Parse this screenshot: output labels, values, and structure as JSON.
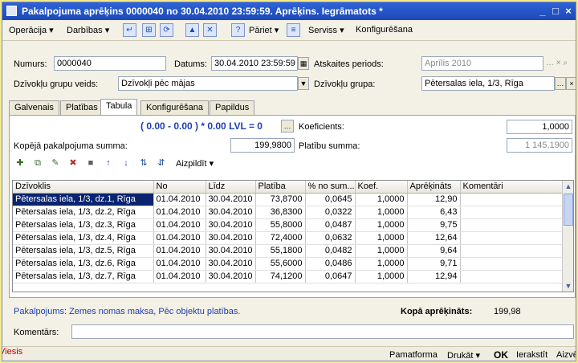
{
  "window": {
    "title": "Pakalpojuma aprēķins 0000040 no 30.04.2010 23:59:59. Aprēķins. Iegrāmatots *",
    "minimize": "_",
    "maximize": "□",
    "close": "×"
  },
  "menu": {
    "operacija": "Operācija ▾",
    "darbibas": "Darbības ▾",
    "pariet": "Pāriet ▾",
    "serviss": "Serviss ▾",
    "konfiguresana": "Konfigurēšana",
    "help": "?"
  },
  "header": {
    "numurs_label": "Numurs:",
    "numurs_value": "0000040",
    "datums_label": "Datums:",
    "datums_value": "30.04.2010 23:59:59",
    "atskaites_label": "Atskaites periods:",
    "atskaites_value": "Aprīlis 2010",
    "grupu_veids_label": "Dzīvokļu grupu veids:",
    "grupu_veids_value": "Dzīvokļi pēc mājas",
    "grupa_label": "Dzīvokļu grupa:",
    "grupa_value": "Pētersalas iela, 1/3, Rīga"
  },
  "tabs": [
    "Galvenais",
    "Platības",
    "Tabula",
    "Konfigurēšana",
    "Papildus"
  ],
  "formula": {
    "text": "( 0.00 - 0.00 ) * 0.00 LVL = 0",
    "koeficients_label": "Koeficients:",
    "koeficients_value": "1,0000",
    "kopeja_label": "Kopējā pakalpojuma summa:",
    "kopeja_value": "199,9800",
    "platibu_label": "Platību summa:",
    "platibu_value": "1 145,1900"
  },
  "grid_toolbar": {
    "aizpildit": "Aizpildīt ▾"
  },
  "table": {
    "columns": [
      "Dzīvoklis",
      "No",
      "Līdz",
      "Platība",
      "% no sum...",
      "Koef.",
      "Aprēķināts",
      "Komentāri"
    ],
    "rows": [
      [
        "Pētersalas iela, 1/3, dz.1, Rīga",
        "01.04.2010",
        "30.04.2010",
        "73,8700",
        "0,0645",
        "1,0000",
        "12,90",
        ""
      ],
      [
        "Pētersalas iela, 1/3, dz.2, Rīga",
        "01.04.2010",
        "30.04.2010",
        "36,8300",
        "0,0322",
        "1,0000",
        "6,43",
        ""
      ],
      [
        "Pētersalas iela, 1/3, dz.3, Rīga",
        "01.04.2010",
        "30.04.2010",
        "55,8000",
        "0,0487",
        "1,0000",
        "9,75",
        ""
      ],
      [
        "Pētersalas iela, 1/3, dz.4, Rīga",
        "01.04.2010",
        "30.04.2010",
        "72,4000",
        "0,0632",
        "1,0000",
        "12,64",
        ""
      ],
      [
        "Pētersalas iela, 1/3, dz.5, Rīga",
        "01.04.2010",
        "30.04.2010",
        "55,1800",
        "0,0482",
        "1,0000",
        "9,64",
        ""
      ],
      [
        "Pētersalas iela, 1/3, dz.6, Rīga",
        "01.04.2010",
        "30.04.2010",
        "55,6000",
        "0,0486",
        "1,0000",
        "9,71",
        ""
      ],
      [
        "Pētersalas iela, 1/3, dz.7, Rīga",
        "01.04.2010",
        "30.04.2010",
        "74,1200",
        "0,0647",
        "1,0000",
        "12,94",
        ""
      ]
    ]
  },
  "footer": {
    "pakalpojums": "Pakalpojums: Zemes nomas maksa,  Pēc objektu platības.",
    "kopa_label": "Kopā aprēķināts:",
    "kopa_value": "199,98",
    "komentars_label": "Komentārs:",
    "komentars_value": ""
  },
  "statusbar": {
    "user": "Viesis",
    "pamatforma": "Pamatforma",
    "drukat": "Drukāt ▾",
    "ok": "OK",
    "ierakstit": "Ierakstīt",
    "aizvert": "Aizvērt"
  },
  "colors": {
    "titlebar": "#1c49b8",
    "selection": "#0a2470",
    "formula_text": "#1a3fb0",
    "status_user": "#c00000"
  }
}
